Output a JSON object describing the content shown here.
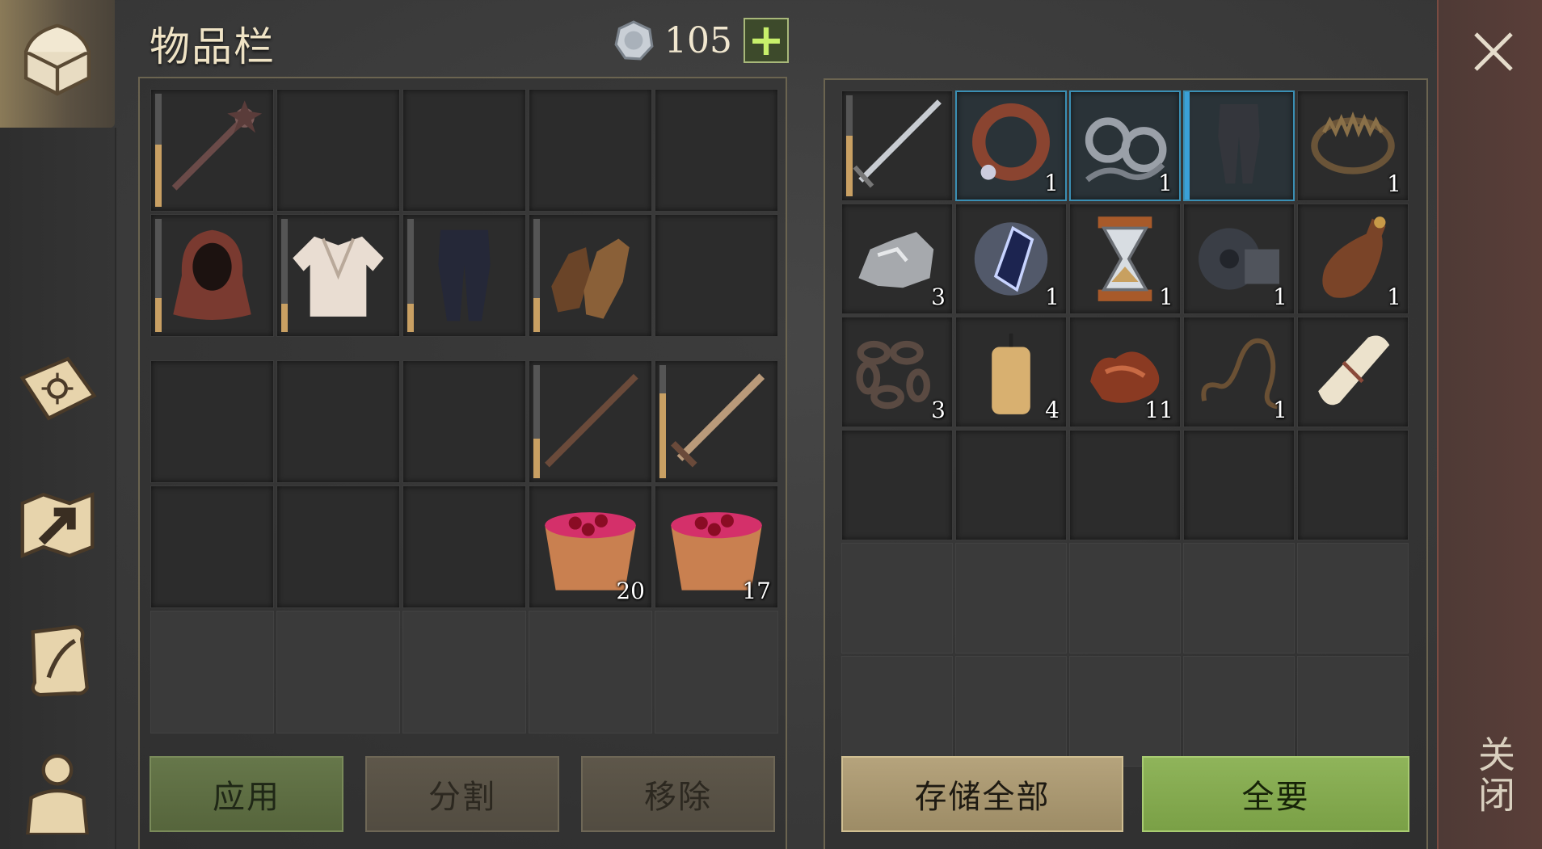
{
  "header": {
    "title": "物品栏",
    "currency_icon": "silver-coin-icon",
    "currency_amount": "105",
    "add_symbol": "+"
  },
  "sidebar": {
    "items": [
      {
        "name": "chest-icon",
        "active": true
      },
      {
        "name": "sun-book-icon",
        "active": false
      },
      {
        "name": "map-arrow-icon",
        "active": false
      },
      {
        "name": "scroll-quill-icon",
        "active": false
      },
      {
        "name": "character-icon",
        "active": false
      }
    ]
  },
  "inventory": {
    "equipment": [
      {
        "icon": "mace-icon",
        "durability": 0.55
      },
      null,
      null,
      null,
      null,
      {
        "icon": "hood-icon",
        "durability": 0.3
      },
      {
        "icon": "shirt-icon",
        "durability": 0.25
      },
      {
        "icon": "pants-icon",
        "durability": 0.25
      },
      {
        "icon": "gloves-icon",
        "durability": 0.3
      },
      null
    ],
    "bag": [
      null,
      null,
      null,
      {
        "icon": "staff-icon",
        "durability": 0.35
      },
      {
        "icon": "sword-icon",
        "durability": 0.75
      },
      null,
      null,
      null,
      {
        "icon": "berry-bucket-icon",
        "qty": "20"
      },
      {
        "icon": "berry-bucket-icon",
        "qty": "17"
      },
      "dim",
      "dim",
      "dim",
      "dim",
      "dim"
    ]
  },
  "container": {
    "slots": [
      {
        "icon": "longsword-icon",
        "durability": 0.6
      },
      {
        "icon": "collar-icon",
        "qty": "1",
        "selected": true
      },
      {
        "icon": "shackles-icon",
        "qty": "1",
        "selected": true
      },
      {
        "icon": "chain-legs-icon",
        "selected": true,
        "selected_left": true
      },
      {
        "icon": "bear-trap-icon",
        "qty": "1"
      },
      {
        "icon": "silver-ore-icon",
        "qty": "3"
      },
      {
        "icon": "crystal-icon",
        "qty": "1"
      },
      {
        "icon": "hourglass-icon",
        "qty": "1"
      },
      {
        "icon": "gear-icon",
        "qty": "1"
      },
      {
        "icon": "leather-bottle-icon",
        "qty": "1"
      },
      {
        "icon": "chain-icon",
        "qty": "3"
      },
      {
        "icon": "candle-icon",
        "qty": "4"
      },
      {
        "icon": "guts-icon",
        "qty": "11"
      },
      {
        "icon": "rope-icon",
        "qty": "1"
      },
      {
        "icon": "paper-scroll-icon"
      },
      null,
      null,
      null,
      null,
      null,
      "dim",
      "dim",
      "dim",
      "dim",
      "dim",
      "dim",
      "dim",
      "dim",
      "dim",
      "dim"
    ]
  },
  "buttons": {
    "apply": "应用",
    "split": "分割",
    "remove": "移除",
    "store_all": "存储全部",
    "take_all": "全要"
  },
  "close": {
    "label": "关闭"
  },
  "colors": {
    "accent_gold": "#c9a063",
    "button_green": "#7aa046",
    "selection_blue": "#3a8fb4"
  }
}
